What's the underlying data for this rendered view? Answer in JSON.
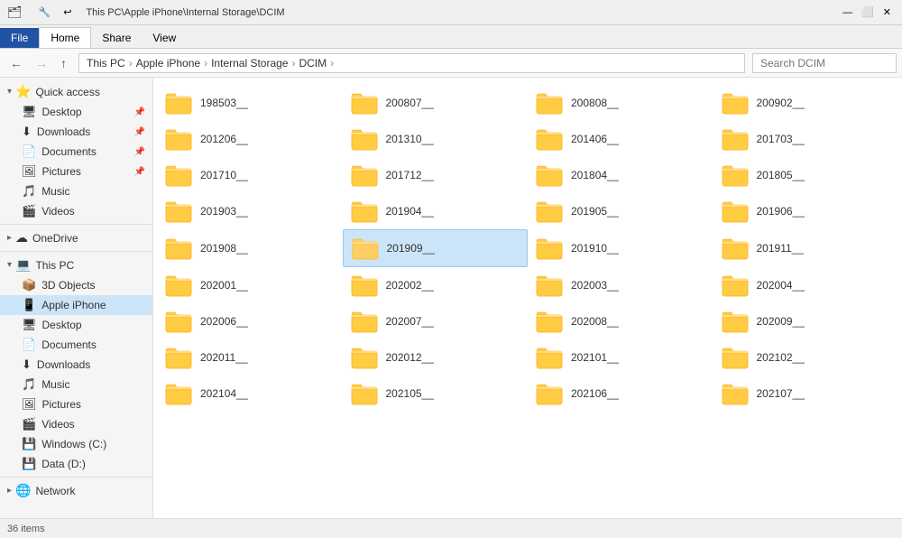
{
  "titlebar": {
    "path": "This PC\\Apple iPhone\\Internal Storage\\DCIM",
    "icon": "🗂"
  },
  "ribbonTabs": [
    {
      "label": "File",
      "type": "file"
    },
    {
      "label": "Home",
      "active": true
    },
    {
      "label": "Share"
    },
    {
      "label": "View"
    }
  ],
  "navbar": {
    "backDisabled": false,
    "forwardDisabled": true,
    "upDisabled": false,
    "breadcrumbs": [
      {
        "label": "This PC"
      },
      {
        "label": "Apple iPhone"
      },
      {
        "label": "Internal Storage"
      },
      {
        "label": "DCIM"
      }
    ],
    "searchPlaceholder": "Search DCIM"
  },
  "sidebar": {
    "sections": [
      {
        "id": "quick-access",
        "label": "Quick access",
        "icon": "⭐",
        "expanded": true,
        "items": [
          {
            "label": "Desktop",
            "icon": "🖥",
            "pinned": true
          },
          {
            "label": "Downloads",
            "icon": "⬇",
            "pinned": true
          },
          {
            "label": "Documents",
            "icon": "📄",
            "pinned": true
          },
          {
            "label": "Pictures",
            "icon": "🖼",
            "pinned": true
          },
          {
            "label": "Music",
            "icon": "🎵",
            "pinned": false
          },
          {
            "label": "Videos",
            "icon": "🎬",
            "pinned": false
          }
        ]
      },
      {
        "id": "onedrive",
        "label": "OneDrive",
        "icon": "☁",
        "expanded": false,
        "items": []
      },
      {
        "id": "this-pc",
        "label": "This PC",
        "icon": "💻",
        "expanded": true,
        "items": [
          {
            "label": "3D Objects",
            "icon": "📦",
            "pinned": false
          },
          {
            "label": "Apple iPhone",
            "icon": "📱",
            "pinned": false,
            "active": true
          },
          {
            "label": "Desktop",
            "icon": "🖥",
            "pinned": false
          },
          {
            "label": "Documents",
            "icon": "📄",
            "pinned": false
          },
          {
            "label": "Downloads",
            "icon": "⬇",
            "pinned": false
          },
          {
            "label": "Music",
            "icon": "🎵",
            "pinned": false
          },
          {
            "label": "Pictures",
            "icon": "🖼",
            "pinned": false
          },
          {
            "label": "Videos",
            "icon": "🎬",
            "pinned": false
          },
          {
            "label": "Windows (C:)",
            "icon": "💾",
            "pinned": false
          },
          {
            "label": "Data (D:)",
            "icon": "💾",
            "pinned": false
          }
        ]
      },
      {
        "id": "network",
        "label": "Network",
        "icon": "🌐",
        "expanded": false,
        "items": []
      }
    ]
  },
  "folders": [
    {
      "name": "198503__",
      "selected": false
    },
    {
      "name": "200807__",
      "selected": false
    },
    {
      "name": "200808__",
      "selected": false
    },
    {
      "name": "200902__",
      "selected": false
    },
    {
      "name": "201206__",
      "selected": false
    },
    {
      "name": "201310__",
      "selected": false
    },
    {
      "name": "201406__",
      "selected": false
    },
    {
      "name": "201703__",
      "selected": false
    },
    {
      "name": "201710__",
      "selected": false
    },
    {
      "name": "201712__",
      "selected": false
    },
    {
      "name": "201804__",
      "selected": false
    },
    {
      "name": "201805__",
      "selected": false
    },
    {
      "name": "201903__",
      "selected": false
    },
    {
      "name": "201904__",
      "selected": false
    },
    {
      "name": "201905__",
      "selected": false
    },
    {
      "name": "201906__",
      "selected": false
    },
    {
      "name": "201908__",
      "selected": false
    },
    {
      "name": "201909__",
      "selected": true
    },
    {
      "name": "201910__",
      "selected": false
    },
    {
      "name": "201911__",
      "selected": false
    },
    {
      "name": "202001__",
      "selected": false
    },
    {
      "name": "202002__",
      "selected": false
    },
    {
      "name": "202003__",
      "selected": false
    },
    {
      "name": "202004__",
      "selected": false
    },
    {
      "name": "202006__",
      "selected": false
    },
    {
      "name": "202007__",
      "selected": false
    },
    {
      "name": "202008__",
      "selected": false
    },
    {
      "name": "202009__",
      "selected": false
    },
    {
      "name": "202011__",
      "selected": false
    },
    {
      "name": "202012__",
      "selected": false
    },
    {
      "name": "202101__",
      "selected": false
    },
    {
      "name": "202102__",
      "selected": false
    },
    {
      "name": "202104__",
      "selected": false
    },
    {
      "name": "202105__",
      "selected": false
    },
    {
      "name": "202106__",
      "selected": false
    },
    {
      "name": "202107__",
      "selected": false
    }
  ],
  "statusbar": {
    "text": "36 items"
  },
  "colors": {
    "folderYellow": "#FFC04D",
    "folderDark": "#E6A800",
    "selectedBg": "#CCE8FF",
    "selectedBorder": "#99C8FF"
  }
}
